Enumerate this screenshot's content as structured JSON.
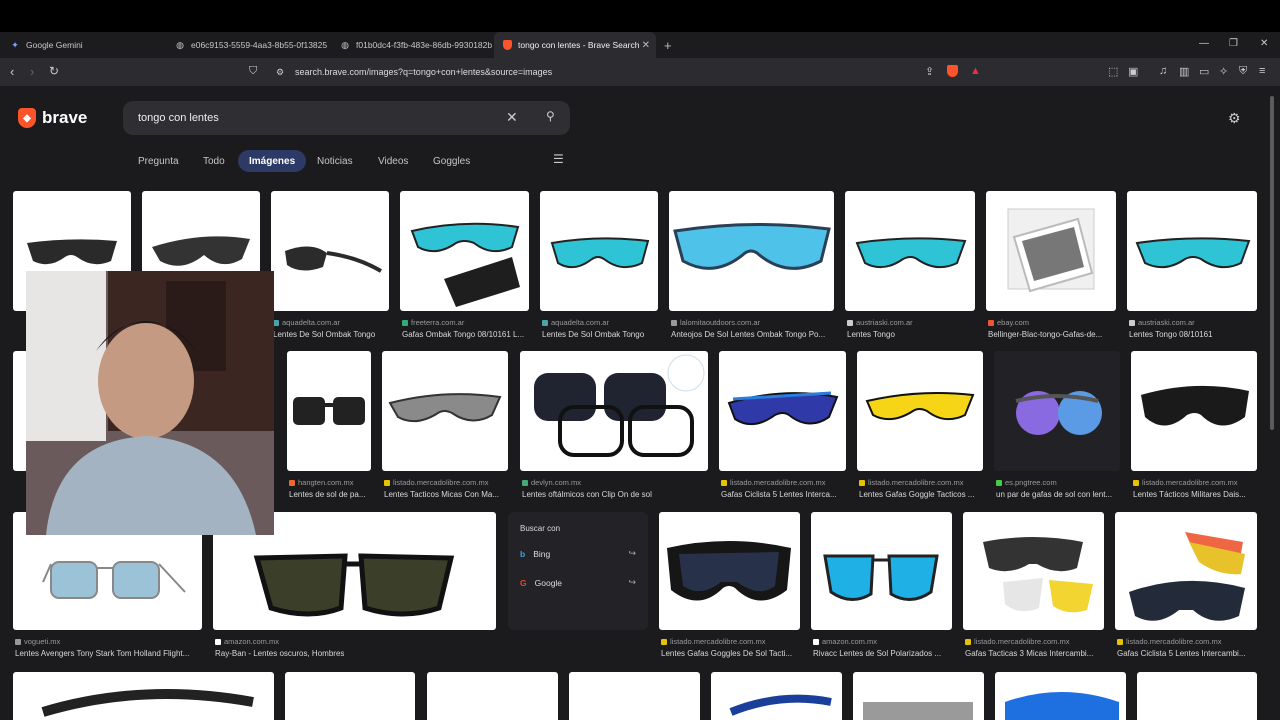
{
  "tabs": [
    {
      "title": "Google Gemini",
      "icon": "gemini-star-icon"
    },
    {
      "title": "e06c9153-5559-4aa3-8b55-0f13825(",
      "icon": "globe-icon"
    },
    {
      "title": "f01b0dc4-f3fb-483e-86db-9930182b",
      "icon": "globe-icon"
    },
    {
      "title": "tongo con lentes - Brave Search",
      "icon": "brave-lion-icon",
      "active": true
    }
  ],
  "address_bar": {
    "url": "search.brave.com/images?q=tongo+con+lentes&source=images"
  },
  "brave": {
    "logo_text": "brave"
  },
  "search": {
    "query": "tongo con lentes"
  },
  "nav_tabs": [
    {
      "label": "Pregunta"
    },
    {
      "label": "Todo"
    },
    {
      "label": "Imágenes",
      "selected": true
    },
    {
      "label": "Noticias"
    },
    {
      "label": "Videos"
    },
    {
      "label": "Goggles"
    }
  ],
  "results_row1": [
    {
      "source": "",
      "title": ""
    },
    {
      "source": "",
      "title": ""
    },
    {
      "source": "aquadelta.com.ar",
      "title": "Lentes De Sol Ombak Tongo"
    },
    {
      "source": "freeterra.com.ar",
      "title": "Gafas Ombak Tongo 08/10161 L..."
    },
    {
      "source": "aquadelta.com.ar",
      "title": "Lentes De Sol Ombak Tongo"
    },
    {
      "source": "lalomitaoutdoors.com.ar",
      "title": "Anteojos De Sol Lentes Ombak Tongo Po..."
    },
    {
      "source": "austriaski.com.ar",
      "title": "Lentes Tongo"
    },
    {
      "source": "ebay.com",
      "title": "Bellinger-Blac-tongo-Gafas-de..."
    },
    {
      "source": "austriaski.com.ar",
      "title": "Lentes Tongo 08/10161"
    }
  ],
  "results_row2": [
    {
      "source": "hangten.com.mx",
      "title": "Lentes de sol de pa..."
    },
    {
      "source": "listado.mercadolibre.com.mx",
      "title": "Lentes Tacticos Micas Con Ma..."
    },
    {
      "source": "devlyn.com.mx",
      "title": "Lentes oftálmicos con Clip On de sol"
    },
    {
      "source": "listado.mercadolibre.com.mx",
      "title": "Gafas Ciclista 5 Lentes Interca..."
    },
    {
      "source": "listado.mercadolibre.com.mx",
      "title": "Lentes Gafas Goggle Tacticos ..."
    },
    {
      "source": "es.pngtree.com",
      "title": "un par de gafas de sol con lent..."
    },
    {
      "source": "listado.mercadolibre.com.mx",
      "title": "Lentes Tácticos Militares Dais..."
    }
  ],
  "results_row3": [
    {
      "source": "vogueti.mx",
      "title": "Lentes Avengers Tony Stark Tom Holland Flight..."
    },
    {
      "source": "amazon.com.mx",
      "title": "Ray-Ban - Lentes oscuros, Hombres"
    },
    {
      "source": "listado.mercadolibre.com.mx",
      "title": "Lentes Gafas Goggles De Sol Tacti..."
    },
    {
      "source": "amazon.com.mx",
      "title": "Rivacc Lentes de Sol Polarizados ..."
    },
    {
      "source": "listado.mercadolibre.com.mx",
      "title": "Gafas Tacticas 3 Micas Intercambi..."
    },
    {
      "source": "listado.mercadolibre.com.mx",
      "title": "Gafas Ciclista 5 Lentes Intercambi..."
    }
  ],
  "buscar_con": {
    "header": "Buscar con",
    "options": [
      {
        "label": "Bing"
      },
      {
        "label": "Google"
      }
    ]
  },
  "colors": {
    "accent": "#fb542b",
    "lens_blue": "#2ec4d6",
    "selected_tab": "#2d3a66"
  }
}
